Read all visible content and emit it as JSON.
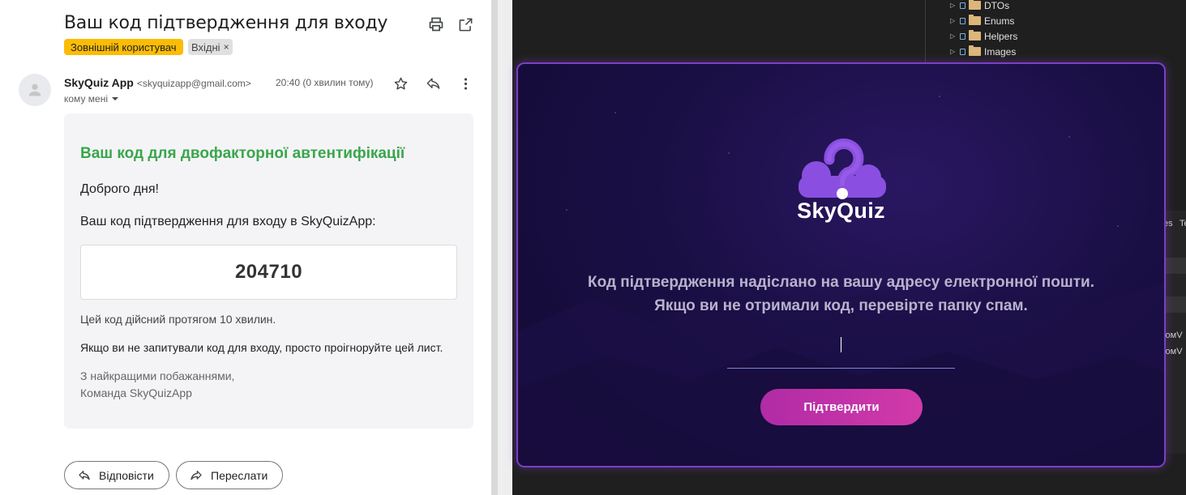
{
  "email": {
    "subject": "Ваш код підтвердження для входу",
    "labels": {
      "external": "Зовнішній користувач",
      "inbox": "Вхідні",
      "inbox_remove": "×"
    },
    "sender": {
      "name": "SkyQuiz App",
      "email": "<skyquizapp@gmail.com>",
      "time": "20:40 (0 хвилин тому)",
      "to": "кому мені"
    },
    "body": {
      "heading": "Ваш код для двофакторної автентифікації",
      "greeting": "Доброго дня!",
      "intro": "Ваш код підтвердження для входу в SkyQuizApp:",
      "code": "204710",
      "validity": "Цей код дійсний протягом 10 хвилин.",
      "ignore_note": "Якщо ви не запитували код для входу, просто проігноруйте цей лист.",
      "sign_off": "З найкращими побажаннями,",
      "team": "Команда SkyQuizApp"
    },
    "actions": {
      "reply": "Відповісти",
      "forward": "Переслати"
    }
  },
  "ide": {
    "tree": [
      "DTOs",
      "Enums",
      "Helpers",
      "Images"
    ],
    "tab_fragments": [
      "es",
      "Te"
    ],
    "code_fragments": [
      "ломV",
      "ломV"
    ]
  },
  "skyquiz": {
    "brand": "SkyQuiz",
    "message_line1": "Код підтвердження надіслано на вашу адресу електронної пошти.",
    "message_line2": "Якщо ви не отримали код, перевірте папку спам.",
    "code_value": "",
    "confirm_label": "Підтвердити"
  },
  "colors": {
    "heading_green": "#3aa64a",
    "label_yellow": "#fbbc04",
    "dialog_border": "#7b3fc6",
    "button_pink": "#c4329f",
    "logo_purple": "#8a4fe0"
  }
}
